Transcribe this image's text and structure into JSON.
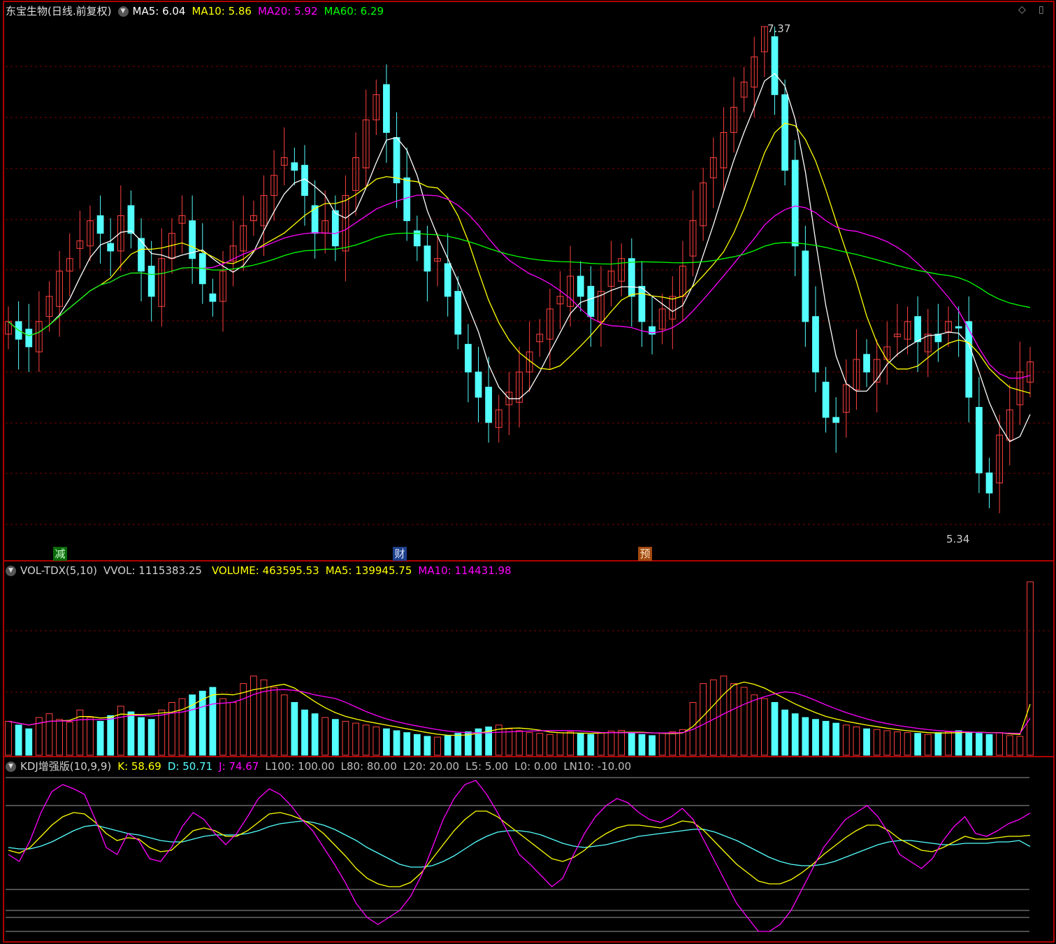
{
  "panels": {
    "price": {
      "stock": "东宝生物",
      "mode": "(日线.前复权)",
      "ma5": "MA5: 6.04",
      "ma10": "MA10: 5.86",
      "ma20": "MA20: 5.92",
      "ma60": "MA60: 6.29",
      "high_label": "7.37",
      "low_label": "5.34",
      "markers": [
        "减",
        "财",
        "预"
      ]
    },
    "vol": {
      "name": "VOL-TDX(5,10)",
      "vvol": "VVOL: 1115383.25",
      "volume": "VOLUME: 463595.53",
      "ma5": "MA5: 139945.75",
      "ma10": "MA10: 114431.98"
    },
    "kdj": {
      "name": "KDJ增强版(10,9,9)",
      "k": "K: 58.69",
      "d": "D: 50.71",
      "j": "J: 74.67",
      "l100": "L100: 100.00",
      "l80": "L80: 80.00",
      "l20": "L20: 20.00",
      "l5": "L5: 5.00",
      "l0": "L0: 0.00",
      "ln10": "LN10: -10.00"
    }
  },
  "colors": {
    "up": "#ff4040",
    "down": "#54ffff",
    "ma5": "#ffffff",
    "ma10": "#ffff00",
    "ma20": "#ff00ff",
    "ma60": "#00ff00",
    "grid": "#7a0000",
    "border": "#b00000"
  },
  "chart_data": [
    {
      "type": "candlestick",
      "title": "东宝生物(日线.前复权)",
      "ylim": [
        5.34,
        7.37
      ],
      "annotations": [
        "7.37",
        "5.34"
      ],
      "series_summary": [
        {
          "name": "MA5",
          "last": 6.04
        },
        {
          "name": "MA10",
          "last": 5.86
        },
        {
          "name": "MA20",
          "last": 5.92
        },
        {
          "name": "MA60",
          "last": 6.29
        }
      ],
      "closes": [
        6.2,
        6.13,
        6.1,
        6.2,
        6.3,
        6.4,
        6.45,
        6.52,
        6.6,
        6.55,
        6.48,
        6.62,
        6.55,
        6.4,
        6.3,
        6.45,
        6.55,
        6.62,
        6.45,
        6.35,
        6.28,
        6.4,
        6.5,
        6.58,
        6.62,
        6.7,
        6.78,
        6.85,
        6.8,
        6.7,
        6.55,
        6.6,
        6.5,
        6.7,
        6.85,
        7.0,
        7.1,
        6.95,
        6.75,
        6.6,
        6.5,
        6.4,
        6.45,
        6.3,
        6.15,
        6.0,
        5.9,
        5.8,
        5.85,
        5.92,
        6.0,
        6.08,
        6.15,
        6.25,
        6.3,
        6.38,
        6.3,
        6.22,
        6.32,
        6.4,
        6.45,
        6.3,
        6.2,
        6.15,
        6.25,
        6.3,
        6.42,
        6.6,
        6.75,
        6.85,
        6.95,
        7.05,
        7.15,
        7.25,
        7.37,
        7.1,
        6.8,
        6.5,
        6.2,
        6.0,
        5.82,
        5.8,
        5.95,
        6.05,
        6.0,
        6.05,
        6.1,
        6.15,
        6.2,
        6.12,
        6.15,
        6.12,
        6.2,
        6.18,
        5.9,
        5.6,
        5.52,
        5.75,
        5.85,
        6.0,
        6.04
      ]
    },
    {
      "type": "bar",
      "title": "VOL-TDX(5,10)",
      "series_summary": [
        {
          "name": "VVOL",
          "last": 1115383.25
        },
        {
          "name": "VOLUME",
          "last": 463595.53
        },
        {
          "name": "MA5",
          "last": 139945.75
        },
        {
          "name": "MA10",
          "last": 114431.98
        }
      ],
      "volumes": [
        90,
        80,
        70,
        100,
        110,
        95,
        88,
        120,
        100,
        90,
        105,
        130,
        115,
        100,
        95,
        120,
        140,
        150,
        160,
        170,
        180,
        150,
        140,
        190,
        210,
        200,
        180,
        160,
        140,
        120,
        110,
        100,
        95,
        90,
        85,
        80,
        75,
        70,
        65,
        60,
        55,
        50,
        48,
        52,
        58,
        62,
        70,
        75,
        80,
        70,
        65,
        60,
        58,
        55,
        60,
        62,
        58,
        55,
        60,
        64,
        66,
        60,
        55,
        52,
        58,
        62,
        68,
        140,
        190,
        200,
        210,
        190,
        180,
        160,
        150,
        140,
        120,
        110,
        100,
        95,
        90,
        85,
        80,
        75,
        70,
        68,
        65,
        62,
        60,
        58,
        55,
        60,
        62,
        65,
        60,
        58,
        55,
        60,
        52,
        50,
        460
      ]
    },
    {
      "type": "line",
      "title": "KDJ增强版(10,9,9)",
      "ylim": [
        -10,
        100
      ],
      "reference_lines": [
        100,
        80,
        20,
        5,
        0,
        -10
      ],
      "series_summary": [
        {
          "name": "K",
          "last": 58.69
        },
        {
          "name": "D",
          "last": 50.71
        },
        {
          "name": "J",
          "last": 74.67
        }
      ],
      "j_values": [
        45,
        40,
        55,
        75,
        90,
        95,
        92,
        88,
        70,
        50,
        45,
        60,
        55,
        42,
        40,
        50,
        65,
        75,
        70,
        60,
        52,
        60,
        72,
        85,
        92,
        88,
        80,
        70,
        62,
        50,
        38,
        25,
        10,
        0,
        -5,
        0,
        5,
        15,
        30,
        50,
        70,
        85,
        95,
        98,
        88,
        75,
        60,
        45,
        38,
        30,
        22,
        28,
        45,
        60,
        72,
        80,
        85,
        82,
        75,
        70,
        68,
        72,
        78,
        70,
        55,
        40,
        25,
        10,
        0,
        -10,
        -10,
        -5,
        5,
        20,
        35,
        50,
        60,
        70,
        75,
        80,
        72,
        60,
        45,
        40,
        35,
        42,
        55,
        65,
        72,
        60,
        58,
        62,
        67,
        70,
        74.67
      ],
      "k_values": [
        48,
        46,
        50,
        58,
        66,
        72,
        75,
        74,
        68,
        60,
        55,
        57,
        56,
        50,
        47,
        48,
        55,
        62,
        64,
        62,
        58,
        58,
        62,
        68,
        74,
        75,
        73,
        70,
        66,
        60,
        52,
        44,
        35,
        28,
        24,
        22,
        22,
        25,
        32,
        42,
        52,
        62,
        70,
        76,
        76,
        72,
        66,
        60,
        54,
        48,
        42,
        40,
        43,
        48,
        55,
        60,
        64,
        66,
        66,
        65,
        64,
        66,
        69,
        68,
        62,
        54,
        46,
        38,
        32,
        26,
        24,
        24,
        27,
        32,
        38,
        45,
        51,
        57,
        62,
        66,
        66,
        62,
        56,
        52,
        48,
        47,
        50,
        54,
        58,
        56,
        56,
        57,
        58,
        58,
        58.69
      ],
      "d_values": [
        50,
        49,
        49,
        51,
        54,
        58,
        62,
        65,
        66,
        64,
        62,
        60,
        59,
        57,
        55,
        54,
        54,
        56,
        58,
        59,
        59,
        59,
        60,
        62,
        65,
        67,
        68,
        69,
        68,
        66,
        63,
        59,
        55,
        50,
        46,
        42,
        38,
        36,
        36,
        37,
        40,
        44,
        49,
        54,
        58,
        61,
        62,
        62,
        61,
        59,
        56,
        53,
        51,
        50,
        51,
        52,
        54,
        56,
        58,
        59,
        60,
        61,
        62,
        63,
        63,
        61,
        58,
        55,
        51,
        47,
        43,
        40,
        38,
        37,
        37,
        38,
        40,
        43,
        46,
        49,
        52,
        54,
        55,
        55,
        54,
        53,
        52,
        52,
        53,
        53,
        53,
        54,
        54,
        55,
        50.71
      ]
    }
  ]
}
